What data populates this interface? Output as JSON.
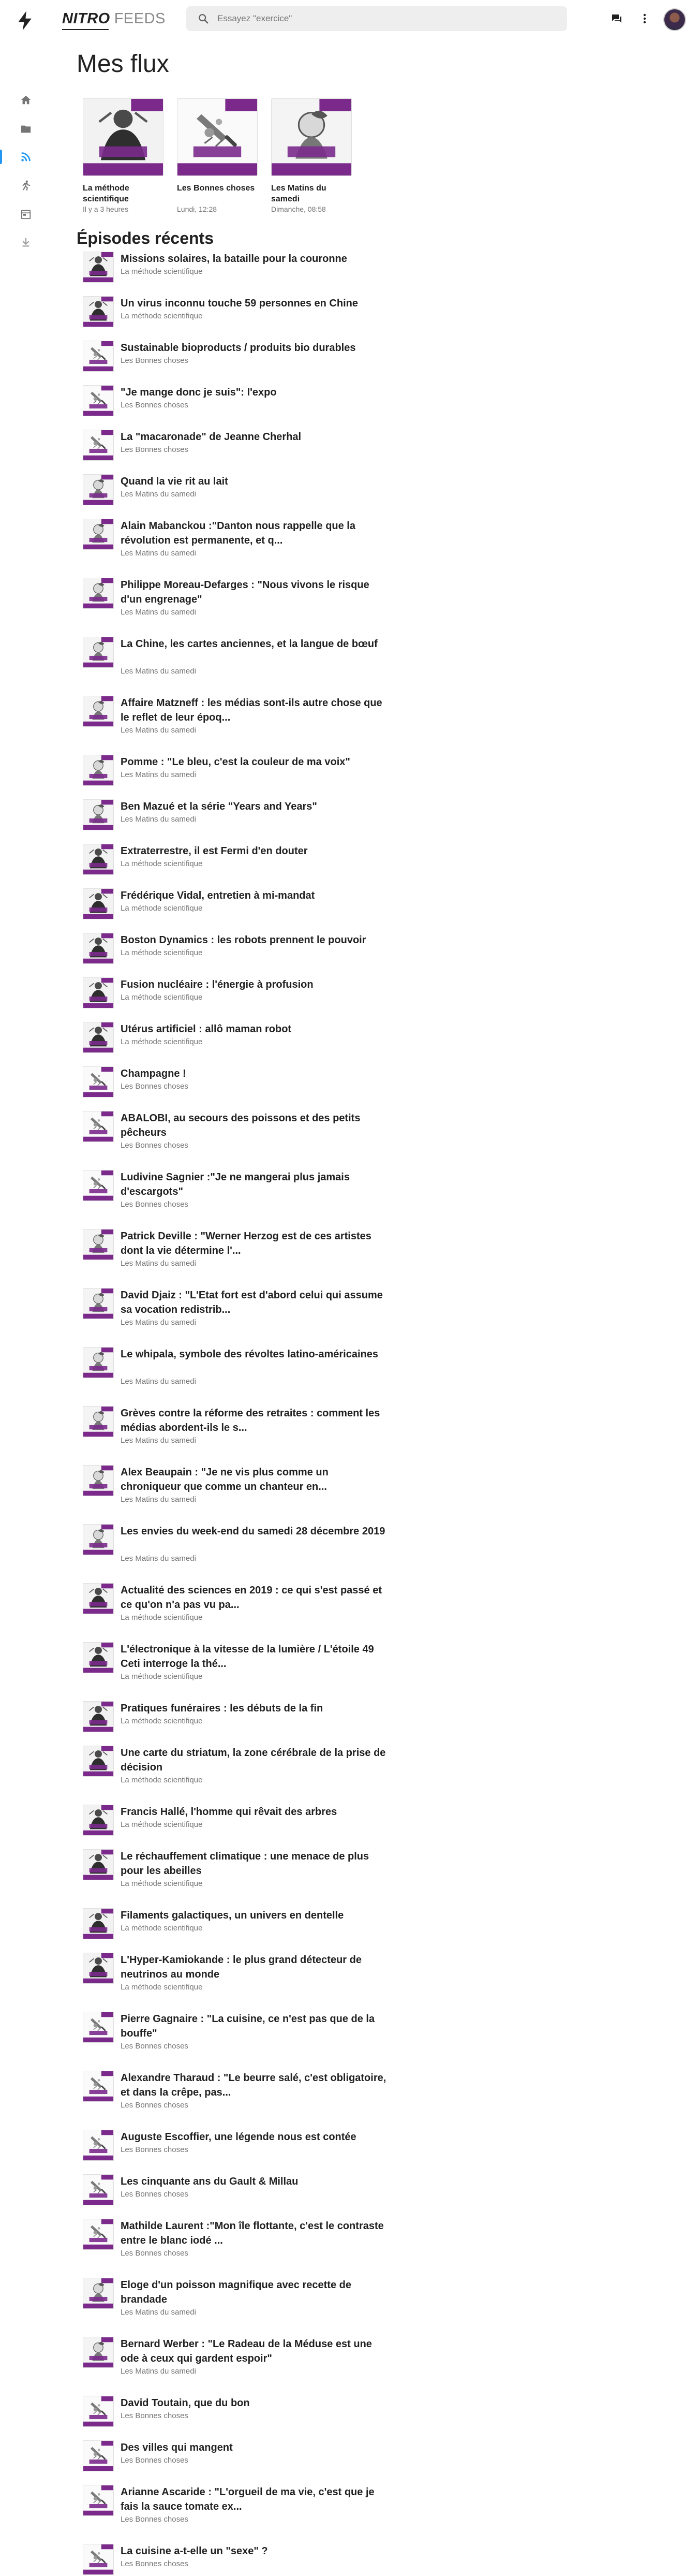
{
  "topbar": {
    "brand_primary": "NITRO",
    "brand_secondary": "FEEDS",
    "search_placeholder": "Essayez \"exercice\"",
    "search_value": ""
  },
  "icons": {
    "logo": "bolt-icon",
    "search": "search-icon",
    "messages": "chat-icon",
    "menu": "more-vert-icon",
    "avatar": "user-avatar"
  },
  "colors": {
    "accent": "#2196f3",
    "brand_purple": "#7b2a8c"
  },
  "sidebar": {
    "items": [
      {
        "icon": "home-icon",
        "active": false
      },
      {
        "icon": "folder-icon",
        "active": false
      },
      {
        "icon": "rss-icon",
        "active": true
      },
      {
        "icon": "running-person-icon",
        "active": false
      },
      {
        "icon": "calendar-icon",
        "active": false
      },
      {
        "icon": "download-icon",
        "active": false
      }
    ]
  },
  "page_title": "Mes flux",
  "feeds": [
    {
      "title": "La méthode scientifique",
      "date": "Il y a 3 heures",
      "cover": "methode"
    },
    {
      "title": "Les Bonnes choses",
      "date": "Lundi, 12:28",
      "cover": "bonnes"
    },
    {
      "title": "Les Matins du samedi",
      "date": "Dimanche, 08:58",
      "cover": "matins"
    }
  ],
  "section_title": "Épisodes récents",
  "episodes": [
    {
      "title": "Missions solaires, la bataille pour la couronne",
      "feed": "La méthode scientifique",
      "cover": "methode"
    },
    {
      "title": "Un virus inconnu touche 59 personnes en Chine",
      "feed": "La méthode scientifique",
      "cover": "methode"
    },
    {
      "title": "Sustainable bioproducts / produits bio durables",
      "feed": "Les Bonnes choses",
      "cover": "bonnes"
    },
    {
      "title": "\"Je mange donc je suis\": l'expo",
      "feed": "Les Bonnes choses",
      "cover": "bonnes"
    },
    {
      "title": "La \"macaronade\" de Jeanne Cherhal",
      "feed": "Les Bonnes choses",
      "cover": "bonnes"
    },
    {
      "title": "Quand la vie rit au lait",
      "feed": "Les Matins du samedi",
      "cover": "matins"
    },
    {
      "title": "Alain Mabanckou :\"Danton nous rappelle que la révolution est permanente, et q...",
      "feed": "Les Matins du samedi",
      "cover": "matins"
    },
    {
      "title": "Philippe Moreau-Defarges : \"Nous vivons le risque d'un engrenage\"",
      "feed": "Les Matins du samedi",
      "cover": "matins"
    },
    {
      "title": "La Chine, les cartes anciennes, et la langue de bœuf",
      "feed": "Les Matins du samedi",
      "cover": "matins"
    },
    {
      "title": "Affaire Matzneff : les médias sont-ils autre chose que le reflet de leur époq...",
      "feed": "Les Matins du samedi",
      "cover": "matins"
    },
    {
      "title": "Pomme : \"Le bleu, c'est la couleur de ma voix\"",
      "feed": "Les Matins du samedi",
      "cover": "matins"
    },
    {
      "title": "Ben Mazué et la série \"Years and Years\"",
      "feed": "Les Matins du samedi",
      "cover": "matins"
    },
    {
      "title": "Extraterrestre, il est Fermi d'en douter",
      "feed": "La méthode scientifique",
      "cover": "methode"
    },
    {
      "title": "Frédérique Vidal, entretien à mi-mandat",
      "feed": "La méthode scientifique",
      "cover": "methode"
    },
    {
      "title": "Boston Dynamics : les robots prennent le pouvoir",
      "feed": "La méthode scientifique",
      "cover": "methode"
    },
    {
      "title": "Fusion nucléaire : l'énergie à profusion",
      "feed": "La méthode scientifique",
      "cover": "methode"
    },
    {
      "title": "Utérus artificiel : allô maman robot",
      "feed": "La méthode scientifique",
      "cover": "methode"
    },
    {
      "title": "Champagne !",
      "feed": "Les Bonnes choses",
      "cover": "bonnes"
    },
    {
      "title": "ABALOBI, au secours des poissons et des petits pêcheurs",
      "feed": "Les Bonnes choses",
      "cover": "bonnes"
    },
    {
      "title": "Ludivine Sagnier :\"Je ne mangerai plus jamais d'escargots\"",
      "feed": "Les Bonnes choses",
      "cover": "bonnes"
    },
    {
      "title": "Patrick Deville : \"Werner Herzog est de ces artistes dont la vie détermine l'...",
      "feed": "Les Matins du samedi",
      "cover": "matins"
    },
    {
      "title": "David Djaiz : \"L'Etat fort est d'abord celui qui assume sa vocation redistrib...",
      "feed": "Les Matins du samedi",
      "cover": "matins"
    },
    {
      "title": "Le whipala, symbole des révoltes latino-américaines",
      "feed": "Les Matins du samedi",
      "cover": "matins"
    },
    {
      "title": "Grèves contre la réforme des retraites : comment les médias abordent-ils le s...",
      "feed": "Les Matins du samedi",
      "cover": "matins"
    },
    {
      "title": "Alex Beaupain : \"Je ne vis plus comme un chroniqueur que comme un chanteur en...",
      "feed": "Les Matins du samedi",
      "cover": "matins"
    },
    {
      "title": "Les envies du week-end du samedi 28 décembre 2019",
      "feed": "Les Matins du samedi",
      "cover": "matins"
    },
    {
      "title": "Actualité des sciences en 2019 : ce qui s'est passé et ce qu'on n'a pas vu pa...",
      "feed": "La méthode scientifique",
      "cover": "methode"
    },
    {
      "title": "L'électronique à la vitesse de la lumière / L'étoile 49 Ceti interroge la thé...",
      "feed": "La méthode scientifique",
      "cover": "methode"
    },
    {
      "title": "Pratiques funéraires : les débuts de la fin",
      "feed": "La méthode scientifique",
      "cover": "methode"
    },
    {
      "title": "Une carte du striatum, la zone cérébrale de la prise de décision",
      "feed": "La méthode scientifique",
      "cover": "methode"
    },
    {
      "title": "Francis Hallé, l'homme qui rêvait des arbres",
      "feed": "La méthode scientifique",
      "cover": "methode"
    },
    {
      "title": "Le réchauffement climatique : une menace de plus pour les abeilles",
      "feed": "La méthode scientifique",
      "cover": "methode"
    },
    {
      "title": "Filaments galactiques, un univers en dentelle",
      "feed": "La méthode scientifique",
      "cover": "methode"
    },
    {
      "title": "L'Hyper-Kamiokande : le plus grand détecteur de neutrinos au monde",
      "feed": "La méthode scientifique",
      "cover": "methode"
    },
    {
      "title": "Pierre Gagnaire : \"La cuisine, ce n'est pas que de la bouffe\"",
      "feed": "Les Bonnes choses",
      "cover": "bonnes"
    },
    {
      "title": "Alexandre Tharaud : \"Le beurre salé, c'est obligatoire, et dans la crêpe, pas...",
      "feed": "Les Bonnes choses",
      "cover": "bonnes"
    },
    {
      "title": "Auguste Escoffier, une légende nous est contée",
      "feed": "Les Bonnes choses",
      "cover": "bonnes"
    },
    {
      "title": "Les cinquante ans du Gault & Millau",
      "feed": "Les Bonnes choses",
      "cover": "bonnes"
    },
    {
      "title": "Mathilde Laurent :\"Mon île flottante, c'est le contraste entre le blanc iodé ...",
      "feed": "Les Bonnes choses",
      "cover": "bonnes"
    },
    {
      "title": "Eloge d'un poisson magnifique avec recette de brandade",
      "feed": "Les Matins du samedi",
      "cover": "matins"
    },
    {
      "title": "Bernard Werber : \"Le Radeau de la Méduse est une ode à ceux qui gardent espoir\"",
      "feed": "Les Matins du samedi",
      "cover": "matins"
    },
    {
      "title": "David Toutain, que du bon",
      "feed": "Les Bonnes choses",
      "cover": "bonnes"
    },
    {
      "title": "Des villes qui mangent",
      "feed": "Les Bonnes choses",
      "cover": "bonnes"
    },
    {
      "title": "Arianne Ascaride : \"L'orgueil de ma vie, c'est que je fais la sauce tomate ex...",
      "feed": "Les Bonnes choses",
      "cover": "bonnes"
    },
    {
      "title": "La cuisine a-t-elle un \"sexe\" ?",
      "feed": "Les Bonnes choses",
      "cover": "bonnes"
    }
  ]
}
